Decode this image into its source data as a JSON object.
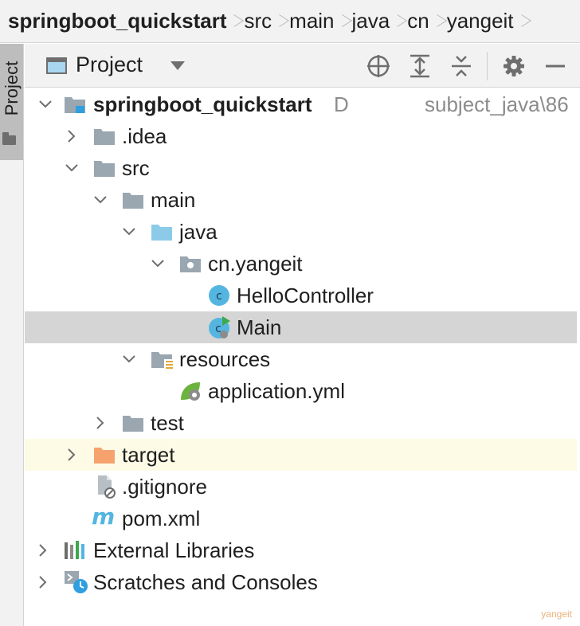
{
  "breadcrumb": {
    "items": [
      "springboot_quickstart",
      "src",
      "main",
      "java",
      "cn",
      "yangeit"
    ]
  },
  "side_strip": {
    "tab_label": "Project"
  },
  "panel_header": {
    "title": "Project",
    "actions": [
      "locate-icon",
      "expand-all-icon",
      "collapse-all-icon",
      "gear-icon",
      "minimize-icon"
    ]
  },
  "tree": {
    "root": {
      "label": "springboot_quickstart",
      "letter": "D",
      "path_hint": "subject_java\\86"
    },
    "idea": {
      "label": ".idea"
    },
    "src": {
      "label": "src"
    },
    "main": {
      "label": "main"
    },
    "java": {
      "label": "java"
    },
    "package": {
      "label": "cn.yangeit"
    },
    "hello_controller": {
      "label": "HelloController",
      "icon_letter": "c"
    },
    "main_class": {
      "label": "Main",
      "icon_letter": "c"
    },
    "resources": {
      "label": "resources"
    },
    "application_yml": {
      "label": "application.yml"
    },
    "test": {
      "label": "test"
    },
    "target": {
      "label": "target"
    },
    "gitignore": {
      "label": ".gitignore"
    },
    "pom": {
      "label": "pom.xml",
      "icon_letter": "m"
    },
    "external_libraries": {
      "label": "External Libraries"
    },
    "scratches": {
      "label": "Scratches and Consoles"
    }
  },
  "watermark": "yangeit",
  "colors": {
    "selected_row": "#d5d5d5",
    "excluded_row": "#fdfbe6",
    "folder_gray": "#9aa7b0",
    "source_folder_blue": "#8ccbe8",
    "excluded_folder_orange": "#f5a26f",
    "class_icon_blue": "#54b6e0",
    "run_green": "#3ea84a"
  }
}
